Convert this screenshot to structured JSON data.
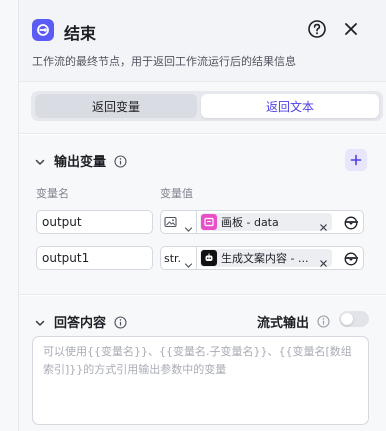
{
  "header": {
    "title": "结束",
    "description": "工作流的最终节点，用于返回工作流运行后的结果信息"
  },
  "mode_tabs": [
    {
      "label": "返回变量",
      "selected": false
    },
    {
      "label": "返回文本",
      "selected": true
    }
  ],
  "output_section": {
    "title": "输出变量",
    "col_name": "变量名",
    "col_value": "变量值",
    "rows": [
      {
        "name": "output",
        "type_icon": "image-icon",
        "ref_icon": "canvas-node-icon",
        "ref_text": "画板 - data"
      },
      {
        "name": "output1",
        "type_text": "str.",
        "ref_icon": "bot-node-icon",
        "ref_text": "生成文案内容 - ..."
      }
    ]
  },
  "answer_section": {
    "title": "回答内容",
    "stream_label": "流式输出",
    "stream_enabled": false,
    "placeholder": "可以使用{{变量名}}、{{变量名.子变量名}}、{{变量名[数组索引]}}的方式引用输出参数中的变量"
  },
  "colors": {
    "accent": "#4e40e5",
    "node_icon_bg": "#5b5bf6",
    "canvas_icon_bg": "#e94fc9",
    "bot_icon_bg": "#111111"
  }
}
